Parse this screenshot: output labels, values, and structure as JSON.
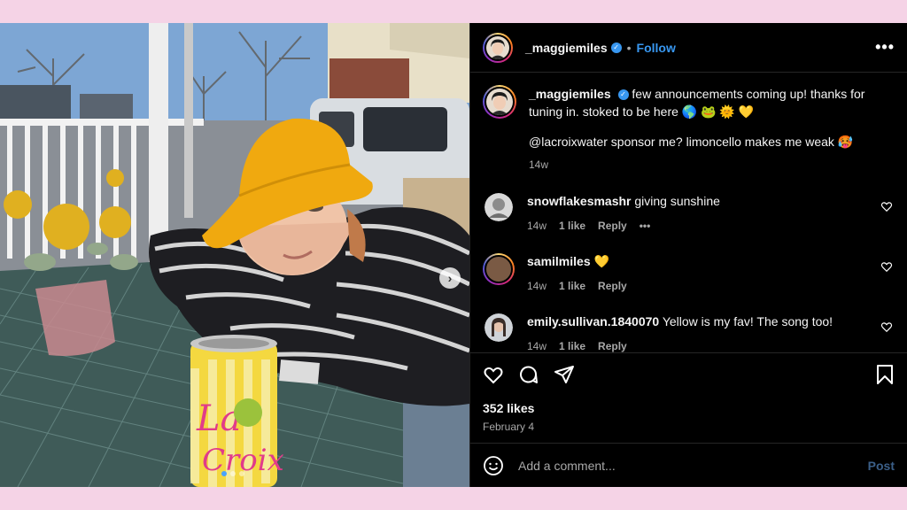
{
  "post": {
    "username": "_maggiemiles",
    "follow_label": "Follow",
    "separator": "•",
    "more_label": "•••",
    "caption_text": "few announcements coming up! thanks for tuning in. stoked to be here 🌎 🐸 🌞 💛",
    "caption_line2": "@lacroixwater sponsor me? limoncello makes me weak 🥵",
    "caption_age": "14w",
    "likes": "352 likes",
    "date": "February 4"
  },
  "comments": [
    {
      "user": "snowflakesmashr",
      "text": "giving sunshine",
      "age": "14w",
      "likes": "1 like",
      "reply": "Reply",
      "more": "•••"
    },
    {
      "user": "samilmiles",
      "text": "💛",
      "age": "14w",
      "likes": "1 like",
      "reply": "Reply"
    },
    {
      "user": "emily.sullivan.1840070",
      "text": "Yellow is my fav! The song too!",
      "age": "14w",
      "likes": "1 like",
      "reply": "Reply"
    }
  ],
  "composer": {
    "placeholder": "Add a comment...",
    "post_label": "Post"
  },
  "icons": {
    "like": "heart-icon",
    "comment": "speech-bubble-icon",
    "share": "paper-plane-icon",
    "save": "bookmark-icon",
    "emoji": "smiley-icon",
    "next": "chevron-right-icon"
  },
  "colors": {
    "accent": "#3897f0",
    "background": "#000000",
    "page_bg": "#f5d3e6"
  }
}
